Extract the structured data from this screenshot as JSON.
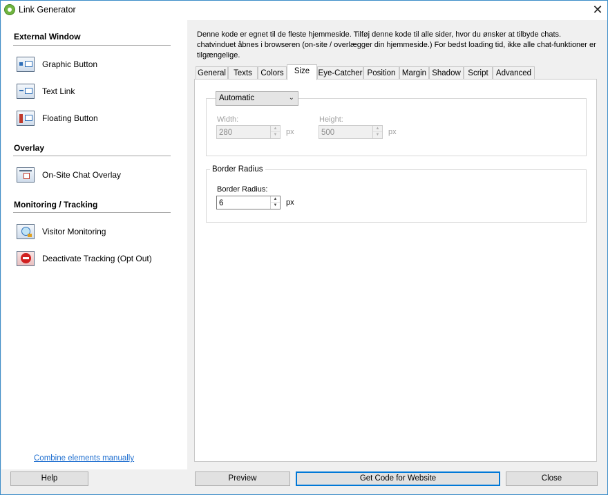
{
  "window": {
    "title": "Link Generator",
    "close_glyph": "✕"
  },
  "sidebar": {
    "sections": [
      {
        "title": "External Window",
        "items": [
          {
            "label": "Graphic Button",
            "icon": "graphic-button-icon"
          },
          {
            "label": "Text Link",
            "icon": "text-link-icon"
          },
          {
            "label": "Floating Button",
            "icon": "floating-button-icon"
          }
        ]
      },
      {
        "title": "Overlay",
        "items": [
          {
            "label": "On-Site Chat Overlay",
            "icon": "chat-overlay-icon"
          }
        ]
      },
      {
        "title": "Monitoring / Tracking",
        "items": [
          {
            "label": "Visitor Monitoring",
            "icon": "visitor-monitoring-icon"
          },
          {
            "label": "Deactivate Tracking (Opt Out)",
            "icon": "deactivate-tracking-icon"
          }
        ]
      }
    ],
    "combine_link": "Combine elements manually"
  },
  "description": "Denne kode er egnet til de fleste hjemmeside. Tilføj denne kode til alle sider, hvor du ønsker at tilbyde chats. chatvinduet åbnes i browseren (on-site / overlægger din hjemmeside.) For bedst loading tid, ikke alle chat-funktioner er tilgængelige.",
  "tabs": [
    "General",
    "Texts",
    "Colors",
    "Size",
    "Eye-Catcher",
    "Position",
    "Margin",
    "Shadow",
    "Script",
    "Advanced"
  ],
  "active_tab": "Size",
  "size_tab": {
    "size_mode": "Automatic",
    "width_label": "Width:",
    "width_value": "280",
    "height_label": "Height:",
    "height_value": "500",
    "unit": "px",
    "border_group_title": "Border Radius",
    "border_radius_label": "Border Radius:",
    "border_radius_value": "6",
    "border_unit": "px"
  },
  "buttons": {
    "help": "Help",
    "preview": "Preview",
    "get_code": "Get Code for Website",
    "close": "Close"
  },
  "colors": {
    "accent": "#0078d7",
    "link": "#1f6fd0",
    "window_border": "#3a8cc8"
  }
}
